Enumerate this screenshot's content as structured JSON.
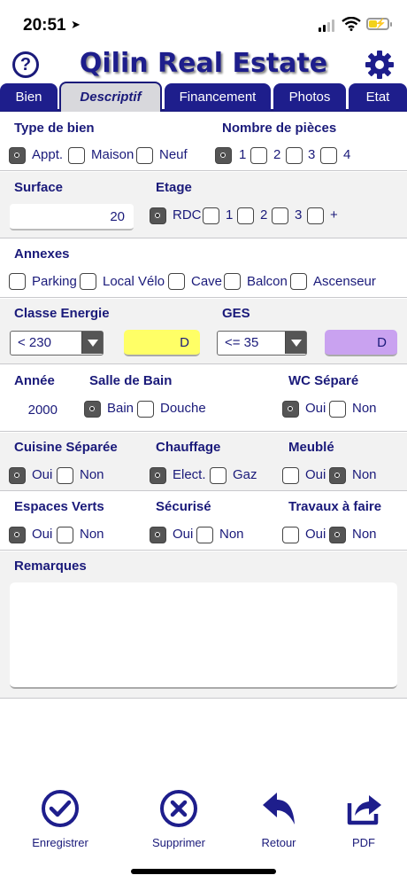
{
  "status_bar": {
    "time": "20:51"
  },
  "header": {
    "title": "Qilin Real Estate",
    "help_icon": "question-circle-icon",
    "settings_icon": "gear-icon",
    "help_glyph": "?"
  },
  "tabs": [
    {
      "label": "Bien"
    },
    {
      "label": "Descriptif",
      "active": true
    },
    {
      "label": "Financement"
    },
    {
      "label": "Photos"
    },
    {
      "label": "Etat"
    }
  ],
  "form": {
    "type_bien": {
      "label": "Type de bien",
      "options": [
        "Appt.",
        "Maison",
        "Neuf"
      ],
      "selected": "Appt."
    },
    "nb_pieces": {
      "label": "Nombre de pièces",
      "options": [
        "1",
        "2",
        "3",
        "4"
      ],
      "selected": "1"
    },
    "surface": {
      "label": "Surface",
      "value": "20"
    },
    "etage": {
      "label": "Etage",
      "options": [
        "RDC",
        "1",
        "2",
        "3",
        "+"
      ],
      "selected": "RDC"
    },
    "annexes": {
      "label": "Annexes",
      "options": [
        "Parking",
        "Local Vélo",
        "Cave",
        "Balcon",
        "Ascenseur"
      ],
      "selected": []
    },
    "classe_energie": {
      "label": "Classe Energie",
      "select_value": "< 230",
      "class": "D",
      "color": "#ffff66"
    },
    "ges": {
      "label": "GES",
      "select_value": "<= 35",
      "class": "D",
      "color": "#c9a2f0"
    },
    "annee": {
      "label": "Année",
      "value": "2000"
    },
    "salle_bain": {
      "label": "Salle de Bain",
      "options": [
        "Bain",
        "Douche"
      ],
      "selected": "Bain"
    },
    "wc_separe": {
      "label": "WC Séparé",
      "options": [
        "Oui",
        "Non"
      ],
      "selected": "Oui"
    },
    "cuisine_separee": {
      "label": "Cuisine Séparée",
      "options": [
        "Oui",
        "Non"
      ],
      "selected": "Oui"
    },
    "chauffage": {
      "label": "Chauffage",
      "options": [
        "Elect.",
        "Gaz"
      ],
      "selected": "Elect."
    },
    "meuble": {
      "label": "Meublé",
      "options": [
        "Oui",
        "Non"
      ],
      "selected": "Non"
    },
    "espaces_verts": {
      "label": "Espaces Verts",
      "options": [
        "Oui",
        "Non"
      ],
      "selected": "Oui"
    },
    "securise": {
      "label": "Sécurisé",
      "options": [
        "Oui",
        "Non"
      ],
      "selected": "Oui"
    },
    "travaux": {
      "label": "Travaux à faire",
      "options": [
        "Oui",
        "Non"
      ],
      "selected": "Non"
    },
    "remarques": {
      "label": "Remarques",
      "value": ""
    }
  },
  "bottom_bar": {
    "save": {
      "label": "Enregistrer",
      "icon": "check-circle-icon"
    },
    "delete": {
      "label": "Supprimer",
      "icon": "x-circle-icon"
    },
    "back": {
      "label": "Retour",
      "icon": "reply-arrow-icon"
    },
    "pdf": {
      "label": "PDF",
      "icon": "share-export-icon"
    }
  },
  "colors": {
    "primary": "#1e1e8c",
    "tab_active_bg": "#d8d8dc",
    "section_gray": "#f2f2f2"
  }
}
